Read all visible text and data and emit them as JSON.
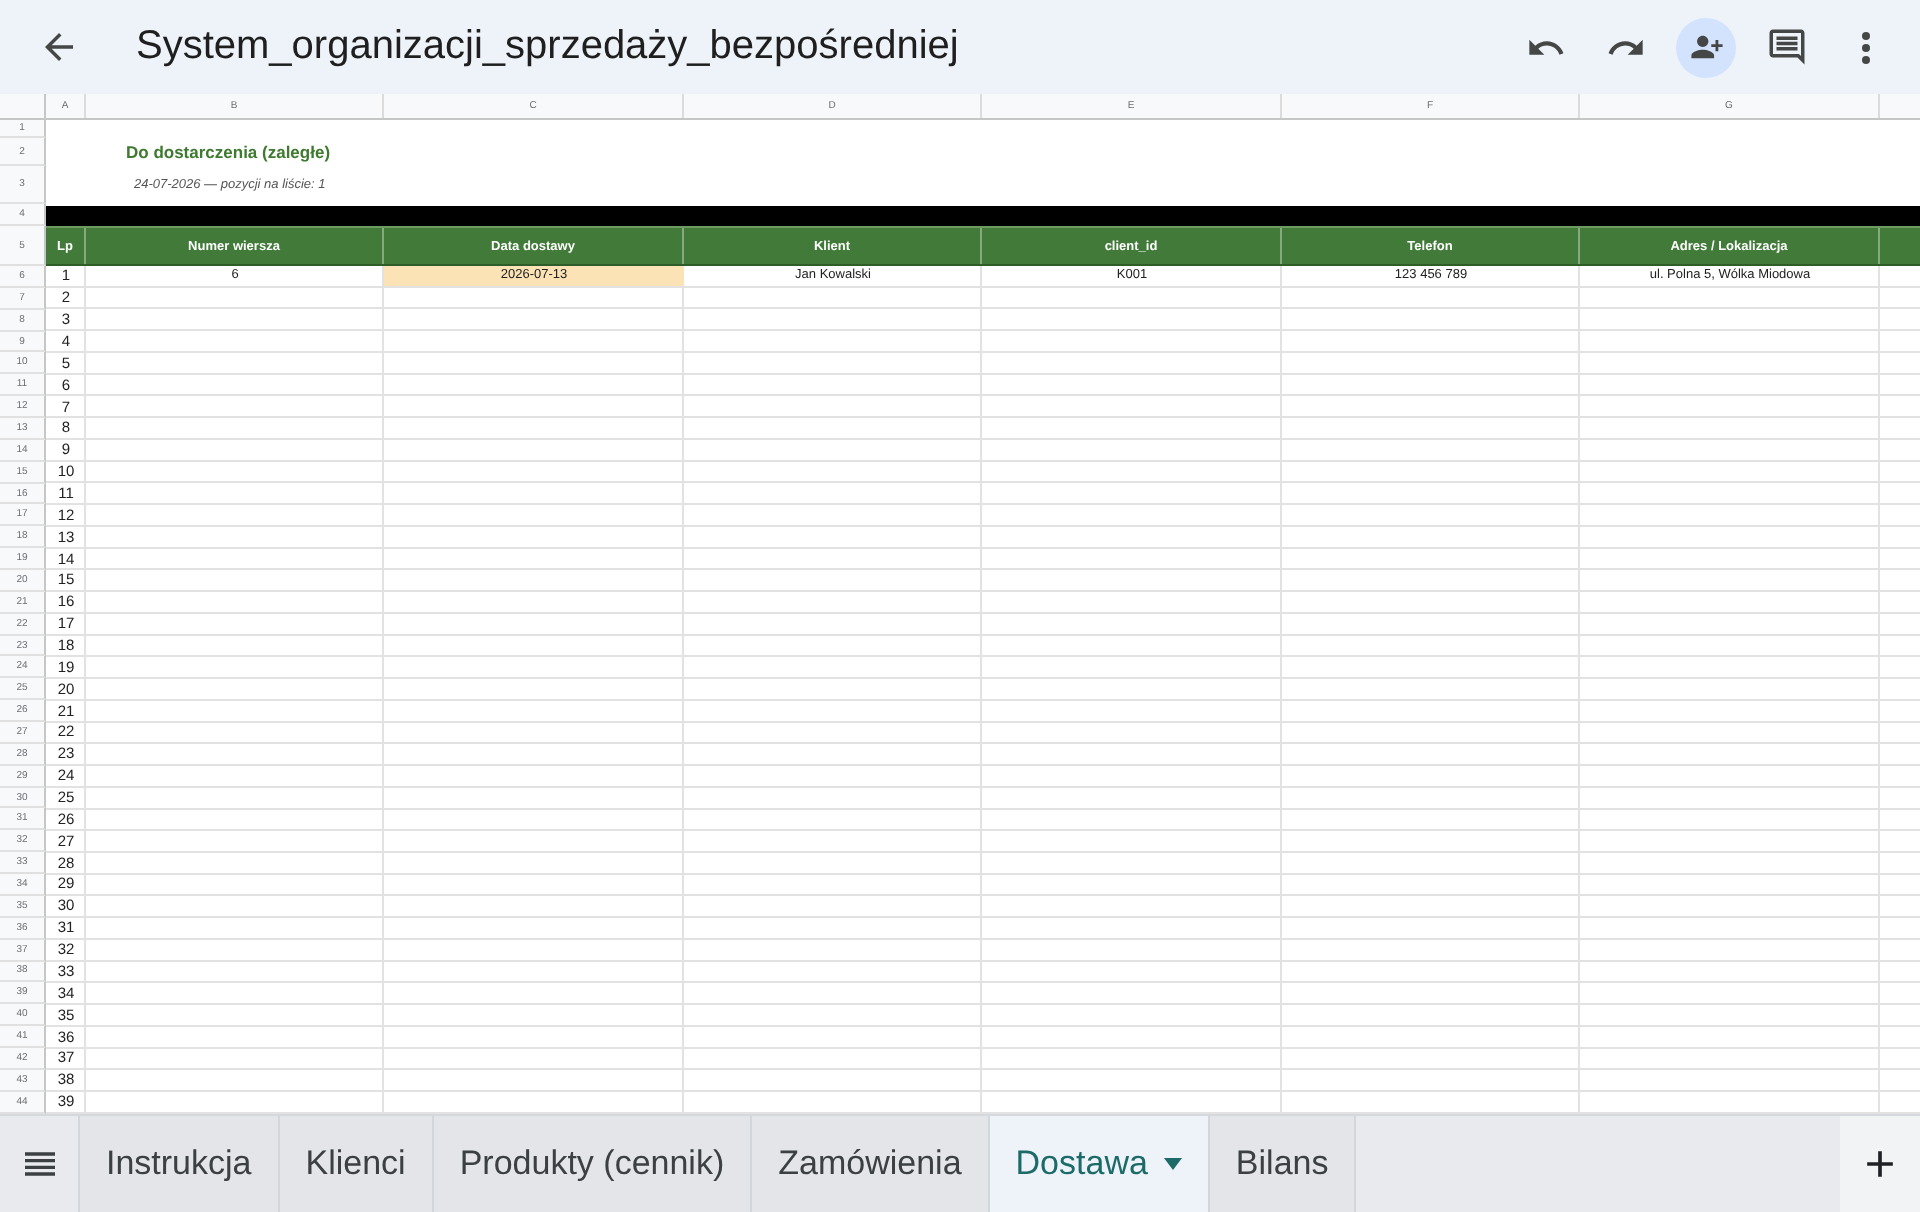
{
  "app_bar": {
    "title": "System_organizacji_sprzedaży_bezpośredniej"
  },
  "column_letters": [
    "A",
    "B",
    "C",
    "D",
    "E",
    "F",
    "G"
  ],
  "row_numbers": [
    "1",
    "2",
    "3",
    "4",
    "5",
    "6",
    "7",
    "8",
    "9",
    "10",
    "11",
    "12",
    "13",
    "14",
    "15",
    "16",
    "17",
    "18",
    "19",
    "20",
    "21",
    "22",
    "23",
    "24",
    "25",
    "26",
    "27",
    "28",
    "29",
    "30",
    "31",
    "32",
    "33",
    "34",
    "35",
    "36",
    "37",
    "38",
    "39",
    "40",
    "41",
    "42",
    "43",
    "44"
  ],
  "report": {
    "title": "Do dostarczenia (zaległe)",
    "subtitle": "24-07-2026 — pozycji na liście: 1"
  },
  "table": {
    "columns": [
      "Lp",
      "Numer wiersza",
      "Data dostawy",
      "Klient",
      "client_id",
      "Telefon",
      "Adres / Lokalizacja"
    ],
    "rows": [
      {
        "cells": [
          {
            "text": "1",
            "highlighted": false
          },
          {
            "text": "6",
            "highlighted": false
          },
          {
            "text": "2026-07-13",
            "highlighted": true
          },
          {
            "text": "Jan Kowalski",
            "highlighted": false
          },
          {
            "text": "K001",
            "highlighted": false
          },
          {
            "text": "123 456 789",
            "highlighted": false
          },
          {
            "text": "ul. Polna 5, Wólka Miodowa",
            "highlighted": false
          }
        ]
      },
      {
        "cells": [
          {
            "text": "2",
            "highlighted": false
          }
        ]
      },
      {
        "cells": [
          {
            "text": "3",
            "highlighted": false
          }
        ]
      },
      {
        "cells": [
          {
            "text": "4",
            "highlighted": false
          }
        ]
      },
      {
        "cells": [
          {
            "text": "5",
            "highlighted": false
          }
        ]
      },
      {
        "cells": [
          {
            "text": "6",
            "highlighted": false
          }
        ]
      },
      {
        "cells": [
          {
            "text": "7",
            "highlighted": false
          }
        ]
      },
      {
        "cells": [
          {
            "text": "8",
            "highlighted": false
          }
        ]
      },
      {
        "cells": [
          {
            "text": "9",
            "highlighted": false
          }
        ]
      },
      {
        "cells": [
          {
            "text": "10",
            "highlighted": false
          }
        ]
      },
      {
        "cells": [
          {
            "text": "11",
            "highlighted": false
          }
        ]
      },
      {
        "cells": [
          {
            "text": "12",
            "highlighted": false
          }
        ]
      },
      {
        "cells": [
          {
            "text": "13",
            "highlighted": false
          }
        ]
      },
      {
        "cells": [
          {
            "text": "14",
            "highlighted": false
          }
        ]
      },
      {
        "cells": [
          {
            "text": "15",
            "highlighted": false
          }
        ]
      },
      {
        "cells": [
          {
            "text": "16",
            "highlighted": false
          }
        ]
      },
      {
        "cells": [
          {
            "text": "17",
            "highlighted": false
          }
        ]
      },
      {
        "cells": [
          {
            "text": "18",
            "highlighted": false
          }
        ]
      },
      {
        "cells": [
          {
            "text": "19",
            "highlighted": false
          }
        ]
      },
      {
        "cells": [
          {
            "text": "20",
            "highlighted": false
          }
        ]
      },
      {
        "cells": [
          {
            "text": "21",
            "highlighted": false
          }
        ]
      },
      {
        "cells": [
          {
            "text": "22",
            "highlighted": false
          }
        ]
      },
      {
        "cells": [
          {
            "text": "23",
            "highlighted": false
          }
        ]
      },
      {
        "cells": [
          {
            "text": "24",
            "highlighted": false
          }
        ]
      },
      {
        "cells": [
          {
            "text": "25",
            "highlighted": false
          }
        ]
      },
      {
        "cells": [
          {
            "text": "26",
            "highlighted": false
          }
        ]
      },
      {
        "cells": [
          {
            "text": "27",
            "highlighted": false
          }
        ]
      },
      {
        "cells": [
          {
            "text": "28",
            "highlighted": false
          }
        ]
      },
      {
        "cells": [
          {
            "text": "29",
            "highlighted": false
          }
        ]
      },
      {
        "cells": [
          {
            "text": "30",
            "highlighted": false
          }
        ]
      },
      {
        "cells": [
          {
            "text": "31",
            "highlighted": false
          }
        ]
      },
      {
        "cells": [
          {
            "text": "32",
            "highlighted": false
          }
        ]
      },
      {
        "cells": [
          {
            "text": "33",
            "highlighted": false
          }
        ]
      },
      {
        "cells": [
          {
            "text": "34",
            "highlighted": false
          }
        ]
      },
      {
        "cells": [
          {
            "text": "35",
            "highlighted": false
          }
        ]
      },
      {
        "cells": [
          {
            "text": "36",
            "highlighted": false
          }
        ]
      },
      {
        "cells": [
          {
            "text": "37",
            "highlighted": false
          }
        ]
      },
      {
        "cells": [
          {
            "text": "38",
            "highlighted": false
          }
        ]
      },
      {
        "cells": [
          {
            "text": "39",
            "highlighted": false
          }
        ]
      }
    ]
  },
  "tabs": [
    {
      "label": "Instrukcja",
      "selected": false
    },
    {
      "label": "Klienci",
      "selected": false
    },
    {
      "label": "Produkty (cennik)",
      "selected": false
    },
    {
      "label": "Zamówienia",
      "selected": false
    },
    {
      "label": "Dostawa",
      "selected": true
    },
    {
      "label": "Bilans",
      "selected": false
    }
  ]
}
